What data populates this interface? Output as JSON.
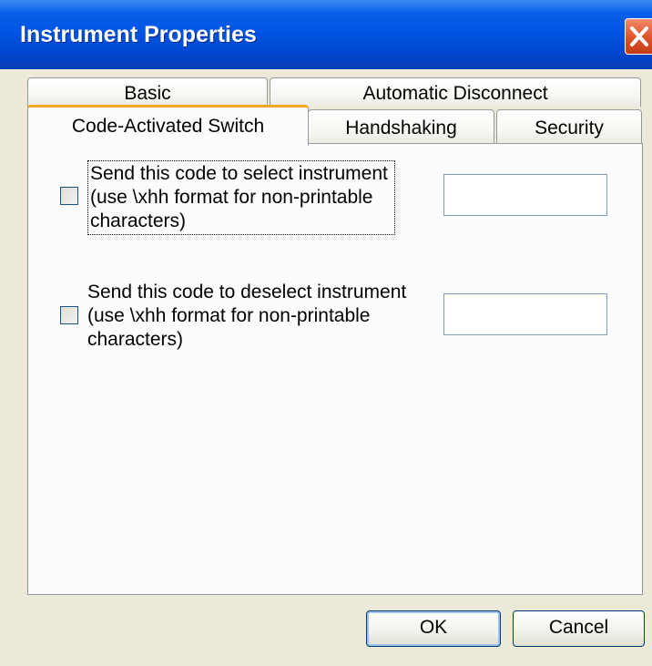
{
  "window": {
    "title": "Instrument Properties"
  },
  "tabs": {
    "basic": "Basic",
    "automatic_disconnect": "Automatic Disconnect",
    "code_activated_switch": "Code-Activated Switch",
    "handshaking": "Handshaking",
    "security": "Security",
    "active": "Code-Activated Switch"
  },
  "select_code": {
    "checked": false,
    "label_lines": [
      "Send this code to select instrument",
      "(use \\xhh format for non-printable",
      "characters)"
    ],
    "value": ""
  },
  "deselect_code": {
    "checked": false,
    "label_lines": [
      "Send this code to deselect instrument",
      "(use \\xhh format for non-printable",
      "characters)"
    ],
    "value": ""
  },
  "buttons": {
    "ok": "OK",
    "cancel": "Cancel"
  },
  "colors": {
    "titlebar": "#0055e5",
    "dialog_bg": "#ece9d8",
    "panel_bg": "#fcfcfe",
    "active_tab_accent": "#f5a623",
    "close_button": "#e0562d"
  }
}
